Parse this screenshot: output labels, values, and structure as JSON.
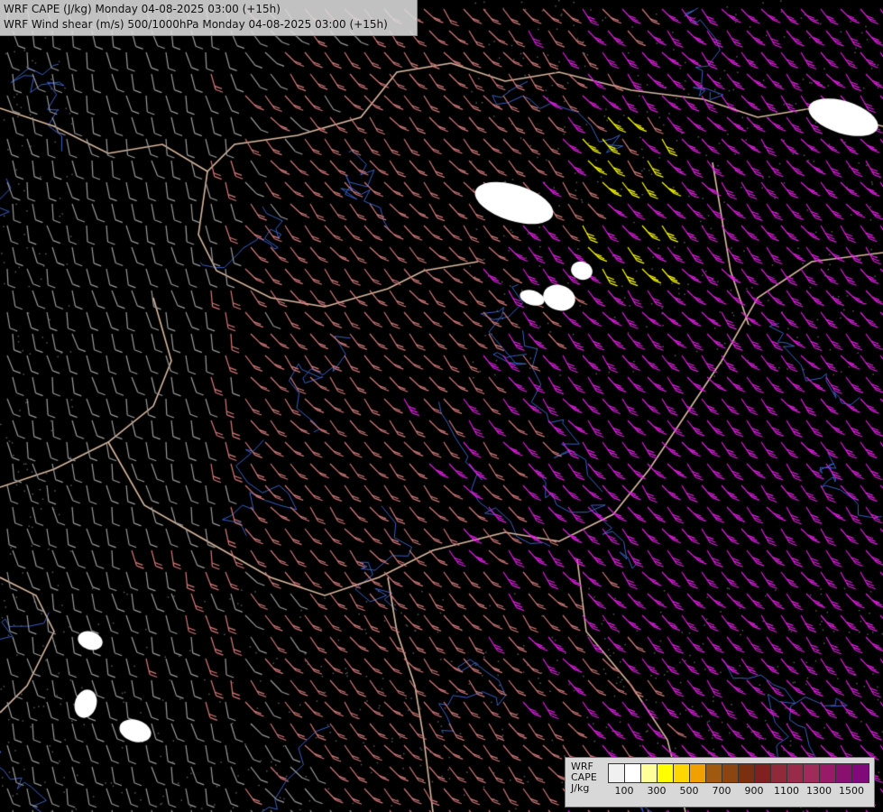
{
  "header": {
    "line1": "WRF CAPE (J/kg) Monday 04-08-2025 03:00 (+15h)",
    "line2": "WRF Wind shear (m/s) 500/1000hPa Monday 04-08-2025 03:00 (+15h)"
  },
  "legend": {
    "label_lines": [
      "WRF",
      "CAPE",
      "J/kg"
    ],
    "colors": [
      "#f0f0f0",
      "#ffffff",
      "#ffff99",
      "#ffff00",
      "#ffd700",
      "#f0a000",
      "#a05a10",
      "#8b4513",
      "#7a3010",
      "#802020",
      "#902a3a",
      "#9a2a4a",
      "#a02a5a",
      "#9a1a6a",
      "#8a1070",
      "#800a78"
    ],
    "tick_labels": [
      "100",
      "300",
      "500",
      "700",
      "900",
      "1100",
      "1300",
      "1500"
    ]
  },
  "map": {
    "background": "#000000",
    "barb_color_low": "#9a9a9a",
    "barb_color_mid": "#d47a7a",
    "barb_color_high": "#e020e0",
    "cape_highlight": "#ffff00",
    "border_color": "#d9b9a0",
    "river_color": "#3a5fc0"
  }
}
